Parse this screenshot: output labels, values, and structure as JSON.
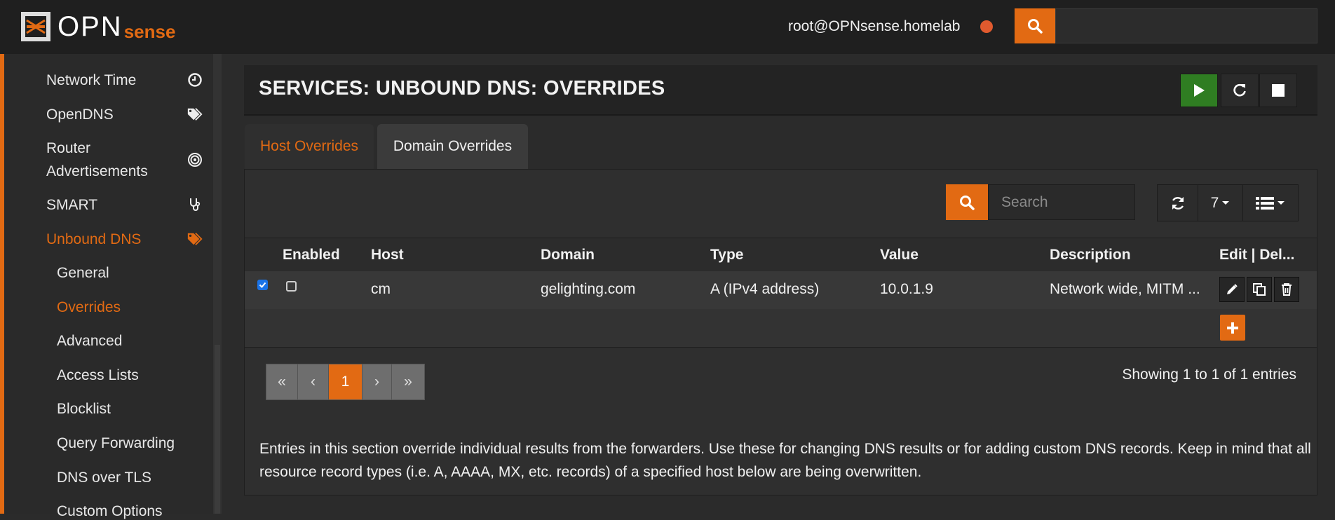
{
  "header": {
    "logo_main": "OPN",
    "logo_sub": "sense",
    "user": "root@OPNsense.homelab"
  },
  "sidebar": {
    "items": [
      {
        "label": "Network Time",
        "icon": "clock-icon"
      },
      {
        "label": "OpenDNS",
        "icon": "tags-icon"
      },
      {
        "label": "Router Advertisements",
        "icon": "bullseye-icon"
      },
      {
        "label": "SMART",
        "icon": "stethoscope-icon"
      },
      {
        "label": "Unbound DNS",
        "icon": "tags-icon",
        "active": true
      }
    ],
    "subitems": [
      "General",
      "Overrides",
      "Advanced",
      "Access Lists",
      "Blocklist",
      "Query Forwarding",
      "DNS over TLS",
      "Custom Options"
    ],
    "active_subitem": "Overrides"
  },
  "page": {
    "title": "SERVICES: UNBOUND DNS: OVERRIDES"
  },
  "tabs": [
    "Host Overrides",
    "Domain Overrides"
  ],
  "grid": {
    "search_placeholder": "Search",
    "page_size": "7",
    "columns": [
      "Enabled",
      "Host",
      "Domain",
      "Type",
      "Value",
      "Description",
      "Edit | Del..."
    ],
    "rows": [
      {
        "selected": true,
        "enabled": false,
        "host": "cm",
        "domain": "gelighting.com",
        "type": "A (IPv4 address)",
        "value": "10.0.1.9",
        "description": "Network wide, MITM ..."
      }
    ],
    "pager": [
      "«",
      "‹",
      "1",
      "›",
      "»"
    ],
    "current_page": "1",
    "showing": "Showing 1 to 1 of 1 entries"
  },
  "note": "Entries in this section override individual results from the forwarders. Use these for changing DNS results or for adding custom DNS records. Keep in mind that all resource record types (i.e. A, AAAA, MX, etc. records) of a specified host below are being overwritten.",
  "colors": {
    "accent": "#e26a13",
    "play": "#2f7d22",
    "status_dot": "#e05a2e"
  }
}
